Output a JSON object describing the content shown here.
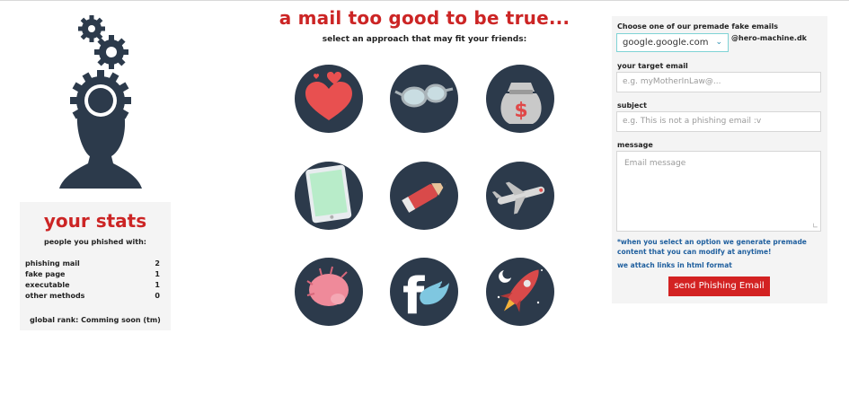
{
  "headline": "a mail too good to be true...",
  "subhead": "select an approach that may fit your friends:",
  "stats": {
    "title": "your stats",
    "subtitle": "people you phished with:",
    "rows": [
      {
        "label": "phishing mail",
        "value": "2"
      },
      {
        "label": "fake page",
        "value": "1"
      },
      {
        "label": "executable",
        "value": "1"
      },
      {
        "label": "other methods",
        "value": "0"
      }
    ],
    "rank": "global rank: Comming soon (tm)"
  },
  "approaches": [
    {
      "icon": "hearts-icon"
    },
    {
      "icon": "glasses-icon"
    },
    {
      "icon": "money-bag-icon"
    },
    {
      "icon": "tablet-icon"
    },
    {
      "icon": "pencil-icon"
    },
    {
      "icon": "airplane-icon"
    },
    {
      "icon": "pink-creature-icon"
    },
    {
      "icon": "facebook-twitter-icon"
    },
    {
      "icon": "rocket-icon"
    }
  ],
  "form": {
    "template_label": "Choose one of our premade fake emails",
    "template_value": "google.google.com",
    "domain_suffix": "@hero-machine.dk",
    "target_label": "your target email",
    "target_placeholder": "e.g. myMotherInLaw@...",
    "subject_label": "subject",
    "subject_placeholder": "e.g. This is not a phishing email :v",
    "message_label": "message",
    "message_placeholder": "Email message",
    "note1": "*when you select an option we generate premade content that you can modify at anytime!",
    "note2": "we attach links in html format",
    "send_label": "send Phishing Email"
  },
  "colors": {
    "accent_red": "#cc2525",
    "navy": "#2c3a4b",
    "link_blue": "#1f5f9e",
    "panel_bg": "#f4f4f4"
  }
}
